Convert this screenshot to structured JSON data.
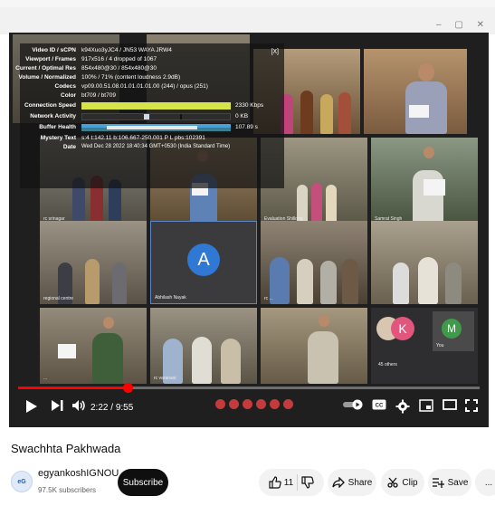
{
  "stats": {
    "close": "[X]",
    "rows": [
      {
        "key": "Video ID / sCPN",
        "value": "k94Xuo3yJC4 / JN53 WAYA JRW4"
      },
      {
        "key": "Viewport / Frames",
        "value": "917x516 / 4 dropped of 1067"
      },
      {
        "key": "Current / Optimal Res",
        "value": "854x480@30 / 854x480@30"
      },
      {
        "key": "Volume / Normalized",
        "value": "100% / 71% (content loudness 2.9dB)"
      },
      {
        "key": "Codecs",
        "value": "vp09.00.51.08.01.01.01.01.00 (244) / opus (251)"
      },
      {
        "key": "Color",
        "value": "bt709 / bt709"
      },
      {
        "key": "Connection Speed",
        "value": "2330 Kbps"
      },
      {
        "key": "Network Activity",
        "value": "0 KB"
      },
      {
        "key": "Buffer Health",
        "value": "107.89 s"
      },
      {
        "key": "Mystery Text",
        "value": "s:4 t:142.11 b:106.667-250.001 P L pbs:102391"
      },
      {
        "key": "Date",
        "value": "Wed Dec 28 2022 18:40:34 GMT+0530 (India Standard Time)"
      }
    ]
  },
  "tiles": {
    "names": [
      "rc srinagar",
      "Evaluation Shillong",
      "Samrat Singh",
      "regional centre",
      "Abhilash Nayak",
      "rc ...",
      "...",
      "rc varanasi",
      "45 others",
      "You"
    ],
    "avatar_letters": {
      "a": "A",
      "k": "K",
      "m": "M"
    }
  },
  "player": {
    "progress_fraction": 0.237,
    "time_current": "2:22",
    "time_separator": " / ",
    "time_total": "9:55"
  },
  "video": {
    "title": "Swachhta Pakhwada"
  },
  "channel": {
    "name": "egyankoshIGNOU",
    "subscribers": "97.5K subscribers",
    "avatar_text": "eG"
  },
  "actions": {
    "subscribe": "Subscribe",
    "like_count": "11",
    "share": "Share",
    "clip": "Clip",
    "save": "Save",
    "more": "..."
  },
  "colors": {
    "progress": "#ff0000",
    "subscribe_bg": "#0f0f0f",
    "avatar_a": "#2f78d4",
    "avatar_k": "#e2557d",
    "avatar_m": "#3f9b49"
  },
  "icons": [
    "play-icon",
    "next-icon",
    "volume-icon",
    "autoplay-toggle-icon",
    "captions-icon",
    "settings-icon",
    "miniplayer-icon",
    "theater-icon",
    "fullscreen-icon",
    "like-icon",
    "dislike-icon",
    "share-icon",
    "clip-icon",
    "save-icon",
    "more-icon"
  ]
}
